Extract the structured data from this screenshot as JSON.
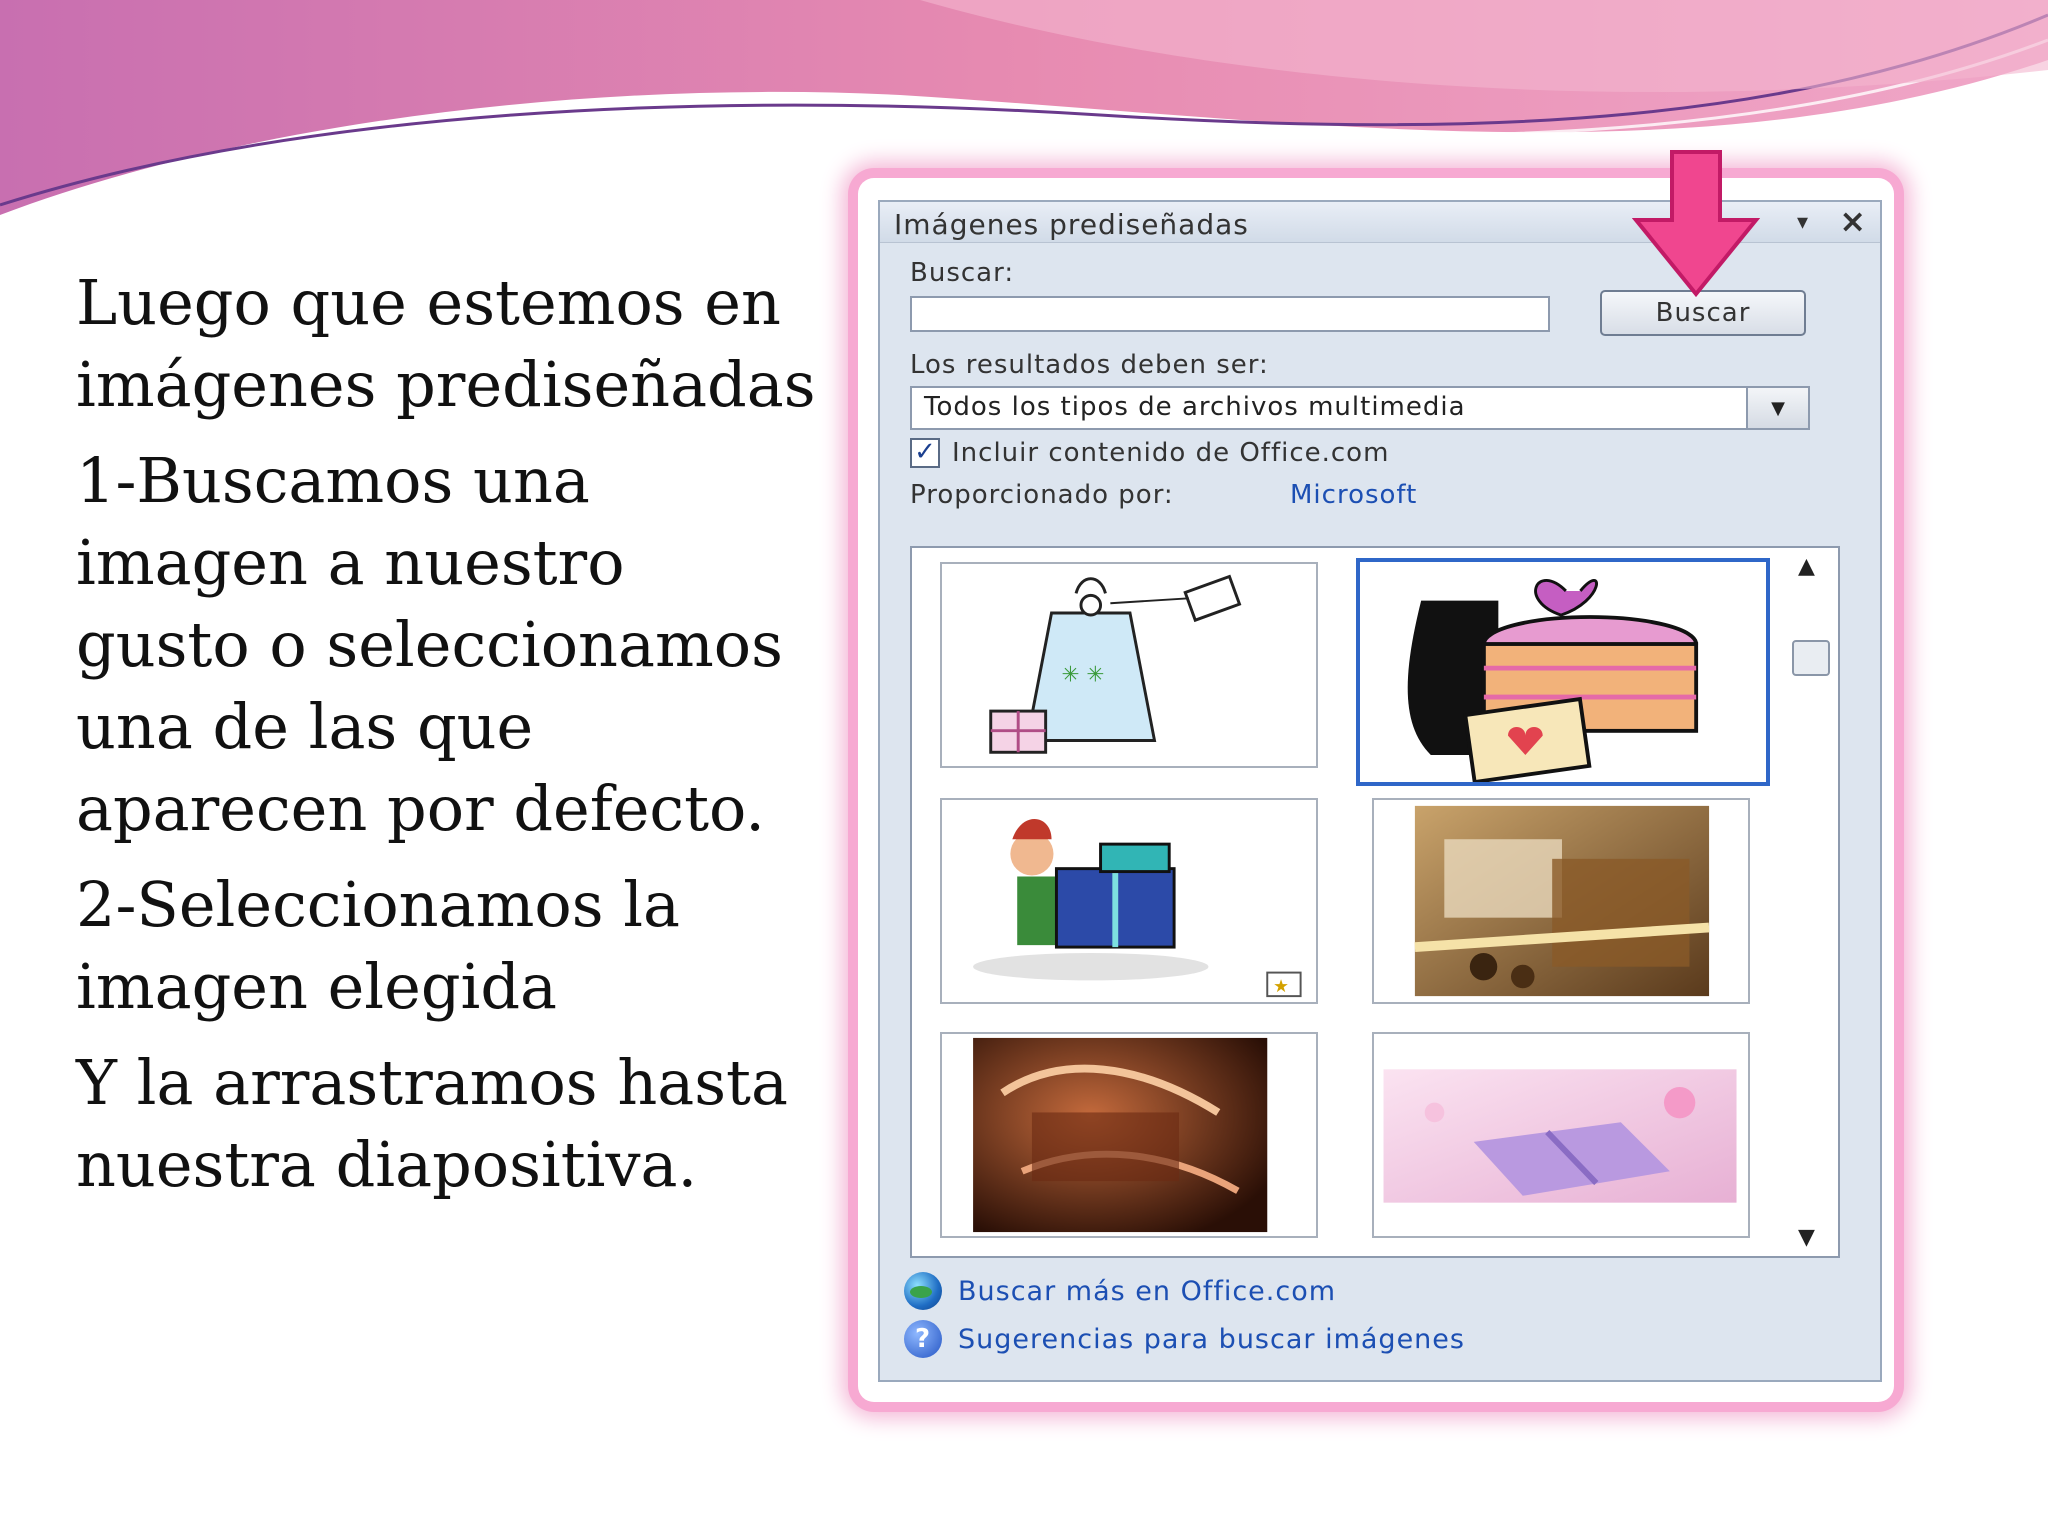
{
  "slide": {
    "paragraphs": [
      "Luego que estemos en imágenes prediseñadas",
      "1-Buscamos una imagen a nuestro gusto o seleccionamos una de las que aparecen por defecto.",
      "2-Seleccionamos la imagen elegida",
      "Y la arrastramos hasta nuestra diapositiva."
    ]
  },
  "panel": {
    "title": "Imágenes prediseñadas",
    "dropdown_icon": "▾",
    "close_icon": "×",
    "search_label": "Buscar:",
    "search_value": "",
    "search_button": "Buscar",
    "results_label": "Los resultados deben ser:",
    "media_type": "Todos los tipos de archivos multimedia",
    "include_checked": "✓",
    "include_label": "Incluir contenido de Office.com",
    "provided_label": "Proporcionado por:",
    "provider": "Microsoft",
    "footer_office": "Buscar más en Office.com",
    "footer_tips": "Sugerencias para buscar imágenes"
  },
  "colors": {
    "wave_pink": "#e07aa8",
    "arrow_pink": "#f0468f",
    "link_blue": "#1c4fb3",
    "selection_blue": "#2f67c8"
  }
}
